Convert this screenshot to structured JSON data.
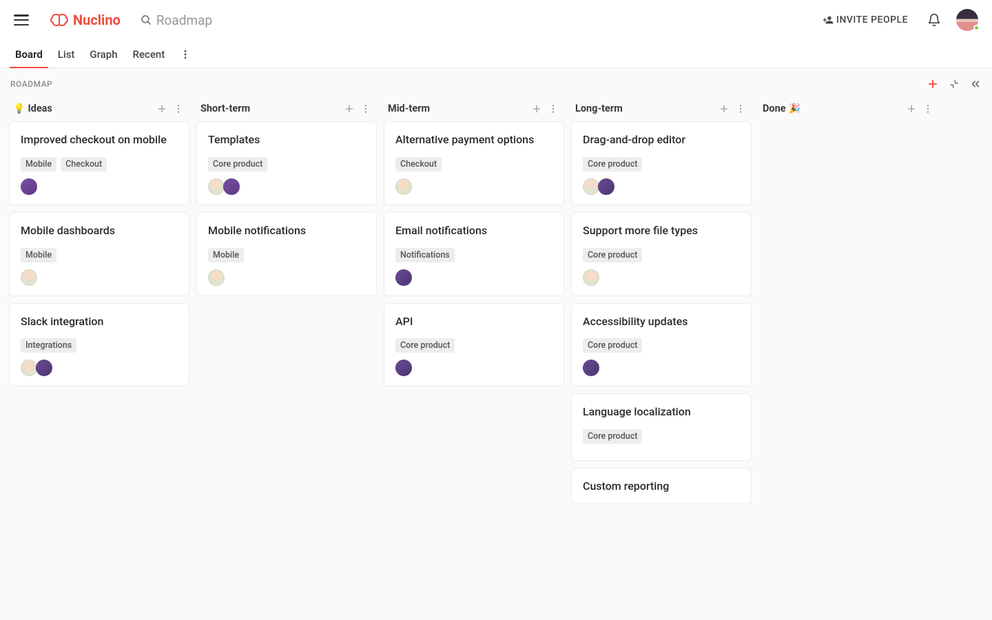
{
  "header": {
    "brand": "Nuclino",
    "search_placeholder": "Roadmap",
    "invite_label": "INVITE PEOPLE"
  },
  "tabs": [
    "Board",
    "List",
    "Graph",
    "Recent"
  ],
  "active_tab_index": 0,
  "breadcrumb": "ROADMAP",
  "columns": [
    {
      "title": "Ideas",
      "emoji": "💡",
      "cards": [
        {
          "title": "Improved checkout on mobile",
          "tags": [
            "Mobile",
            "Checkout"
          ],
          "avatars": [
            "av2"
          ]
        },
        {
          "title": "Mobile dashboards",
          "tags": [
            "Mobile"
          ],
          "avatars": [
            "av1"
          ]
        },
        {
          "title": "Slack integration",
          "tags": [
            "Integrations"
          ],
          "avatars": [
            "av1",
            "av3"
          ]
        }
      ]
    },
    {
      "title": "Short-term",
      "emoji": "",
      "cards": [
        {
          "title": "Templates",
          "tags": [
            "Core product"
          ],
          "avatars": [
            "av1",
            "av2"
          ]
        },
        {
          "title": "Mobile notifications",
          "tags": [
            "Mobile"
          ],
          "avatars": [
            "av1"
          ]
        }
      ]
    },
    {
      "title": "Mid-term",
      "emoji": "",
      "cards": [
        {
          "title": "Alternative payment options",
          "tags": [
            "Checkout"
          ],
          "avatars": [
            "av1"
          ]
        },
        {
          "title": "Email notifications",
          "tags": [
            "Notifications"
          ],
          "avatars": [
            "av3"
          ]
        },
        {
          "title": "API",
          "tags": [
            "Core product"
          ],
          "avatars": [
            "av3"
          ]
        }
      ]
    },
    {
      "title": "Long-term",
      "emoji": "",
      "cards": [
        {
          "title": "Drag-and-drop editor",
          "tags": [
            "Core product"
          ],
          "avatars": [
            "av1",
            "av3"
          ]
        },
        {
          "title": "Support more file types",
          "tags": [
            "Core product"
          ],
          "avatars": [
            "av1"
          ]
        },
        {
          "title": "Accessibility updates",
          "tags": [
            "Core product"
          ],
          "avatars": [
            "av3"
          ]
        },
        {
          "title": "Language localization",
          "tags": [
            "Core product"
          ],
          "avatars": []
        },
        {
          "title": "Custom reporting",
          "tags": [],
          "avatars": []
        }
      ]
    },
    {
      "title": "Done",
      "emoji": "🎉",
      "emoji_after": true,
      "cards": []
    }
  ]
}
